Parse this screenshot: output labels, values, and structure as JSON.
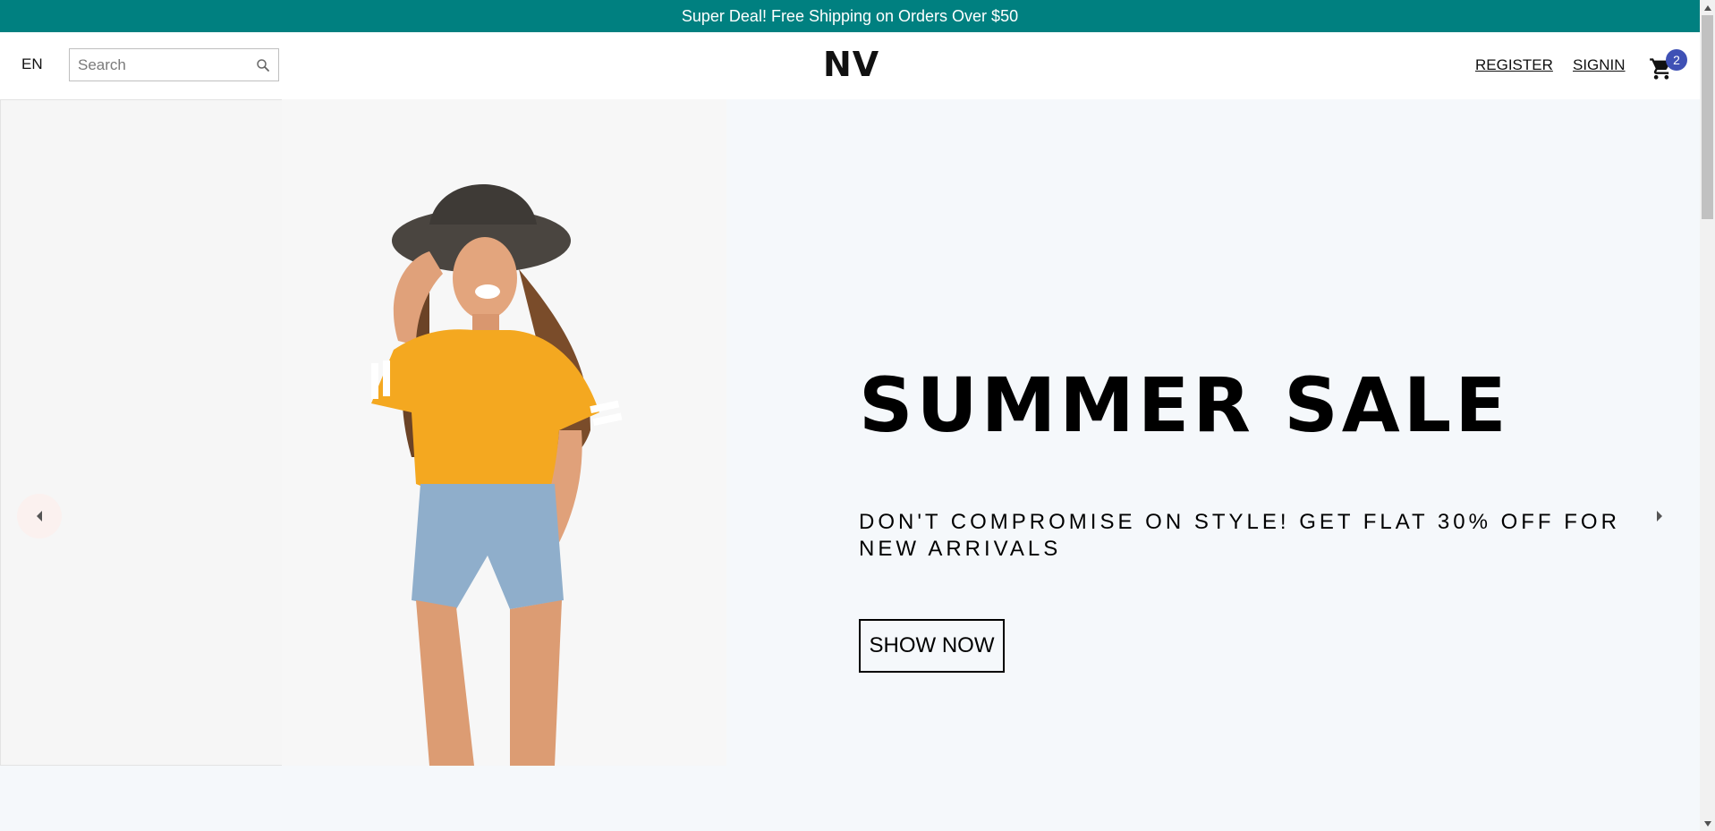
{
  "announcement": {
    "text": "Super Deal! Free Shipping on Orders Over $50",
    "bg_color": "#008080"
  },
  "header": {
    "language": "EN",
    "search": {
      "placeholder": "Search",
      "value": "",
      "icon": "search-icon"
    },
    "logo": "NV",
    "links": {
      "register": "REGISTER",
      "signin": "SIGNIN"
    },
    "cart": {
      "icon": "cart-icon",
      "count": "2",
      "badge_color": "#3f51b5"
    }
  },
  "slider": {
    "title": "SUMMER SALE",
    "description": "DON'T COMPROMISE ON STYLE! GET FLAT 30% OFF FOR NEW ARRIVALS",
    "button_label": "SHOW NOW",
    "prev_icon": "arrow-left-icon",
    "next_icon": "arrow-right-icon"
  }
}
